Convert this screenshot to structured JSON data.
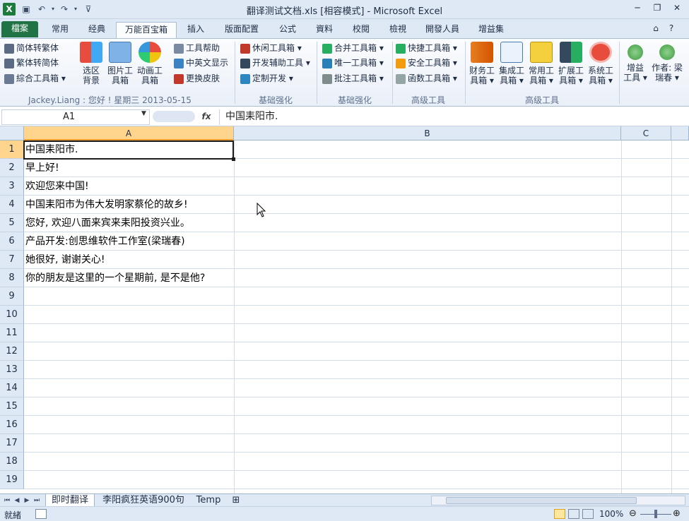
{
  "window": {
    "title": "翻译测试文档.xls [相容模式] - Microsoft Excel"
  },
  "tabs": [
    {
      "label": "檔案",
      "kind": "file"
    },
    {
      "label": "常用"
    },
    {
      "label": "经典"
    },
    {
      "label": "万能百宝箱",
      "active": true
    },
    {
      "label": "插入"
    },
    {
      "label": "版面配置"
    },
    {
      "label": "公式"
    },
    {
      "label": "資料"
    },
    {
      "label": "校閱"
    },
    {
      "label": "檢視"
    },
    {
      "label": "開發人員"
    },
    {
      "label": "增益集"
    }
  ],
  "ribbon": {
    "small_items": {
      "simp_to_trad": "简体转繁体",
      "trad_to_simp": "繁体转简体",
      "combo_tools": "綜合工具箱",
      "tool_help": "工具帮助",
      "cn_en_display": "中英文显示",
      "change_skin": "更换皮肤",
      "leisure_tools": "休闲工具箱",
      "dev_assist": "开发辅助工具",
      "custom_dev": "定制开发",
      "merge_tools": "合并工具箱",
      "unique_tools": "唯一工具箱",
      "comment_tools": "批注工具箱",
      "quick_tools": "快捷工具箱",
      "security_tools": "安全工具箱",
      "function_tools": "函数工具箱"
    },
    "big_items": {
      "select_bg": "选区\n背景",
      "picture_tools": "图片工\n具箱",
      "animation_tools": "动画工\n具箱",
      "finance_tools": "财务工\n具箱",
      "integration_tools": "集成工\n具箱",
      "common_tools": "常用工\n具箱",
      "extension_tools": "扩展工\n具箱",
      "system_tools": "系统工\n具箱",
      "addin_tools": "增益\n工具",
      "author": "作者: 梁\n瑞春"
    },
    "user_line": "Jackey.Liang : 您好 ! 星期三 2013-05-15",
    "group_labels": {
      "basic1": "基础强化",
      "basic2": "基础强化",
      "advanced1": "高级工具",
      "advanced2": "高级工具"
    }
  },
  "formula_bar": {
    "name_box": "A1",
    "fx_label": "fx",
    "content": "中国耒阳市."
  },
  "grid": {
    "columns": [
      "A",
      "B",
      "C"
    ],
    "rows": [
      "1",
      "2",
      "3",
      "4",
      "5",
      "6",
      "7",
      "8",
      "9",
      "10",
      "11",
      "12",
      "13",
      "14",
      "15",
      "16",
      "17",
      "18",
      "19"
    ],
    "cells_A": [
      "中国耒阳市.",
      "早上好!",
      "欢迎您来中国!",
      "中国耒阳市为伟大发明家蔡伦的故乡!",
      "您好, 欢迎八面来宾来耒阳投资兴业。",
      "产品开发:创思维软件工作室(梁瑞春)",
      "她很好, 谢谢关心!",
      "你的朋友是这里的一个星期前, 是不是他?"
    ]
  },
  "sheets": [
    "即时翻译",
    "李阳疯狂英语900句",
    "Temp"
  ],
  "status": {
    "text": "就緒",
    "zoom": "100%"
  },
  "colors": {
    "accent": "#217346",
    "header_bg": "#dfe9f5",
    "selected_header": "#ffd58d"
  }
}
